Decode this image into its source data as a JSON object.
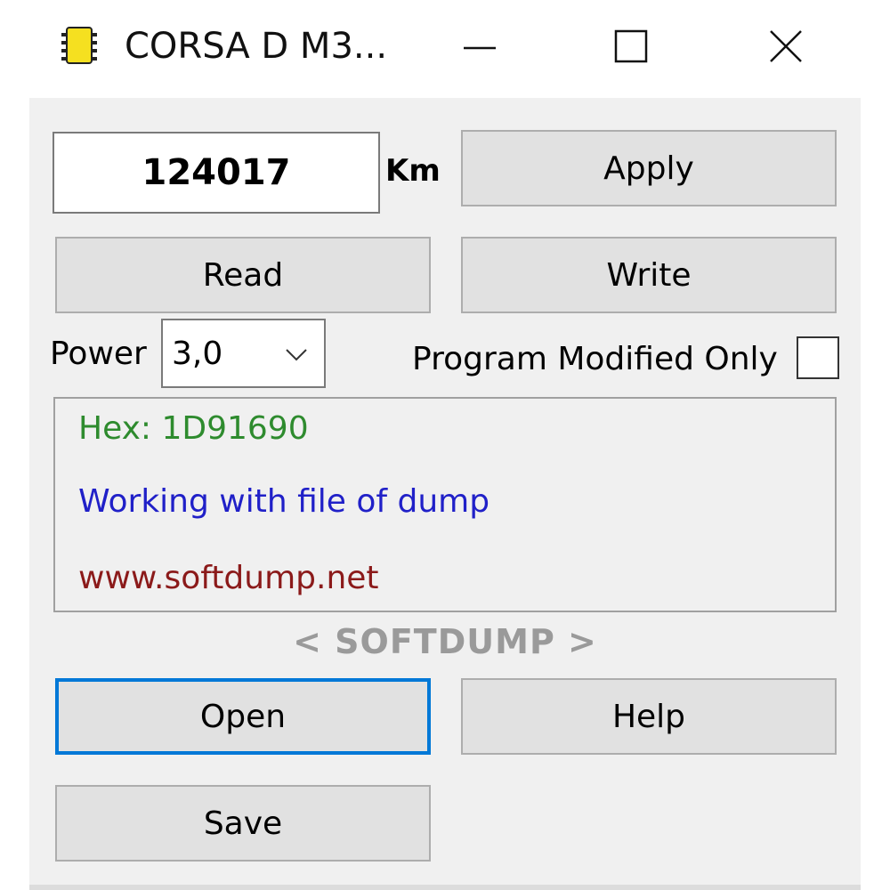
{
  "window": {
    "title": "CORSA D M3...",
    "icon": "chip-icon",
    "controls": [
      "minimize-icon",
      "maximize-icon",
      "close-icon"
    ]
  },
  "odometer": {
    "value": "124017",
    "unit": "Km"
  },
  "buttons": {
    "apply": "Apply",
    "read": "Read",
    "write": "Write",
    "open": "Open",
    "help": "Help",
    "save": "Save"
  },
  "power": {
    "label": "Power",
    "selected": "3,0"
  },
  "program_modified_only": {
    "label": "Program Modified Only",
    "checked": false
  },
  "log": {
    "hex": "Hex: 1D91690",
    "status": "Working with file of dump",
    "website": "www.softdump.net"
  },
  "brand": "< SOFTDUMP >",
  "colors": {
    "hex_text": "#2e8b2e",
    "status_text": "#2020c8",
    "website_text": "#8b1a1a",
    "focus_border": "#0078d7",
    "brand_text": "#9a9a9a"
  }
}
